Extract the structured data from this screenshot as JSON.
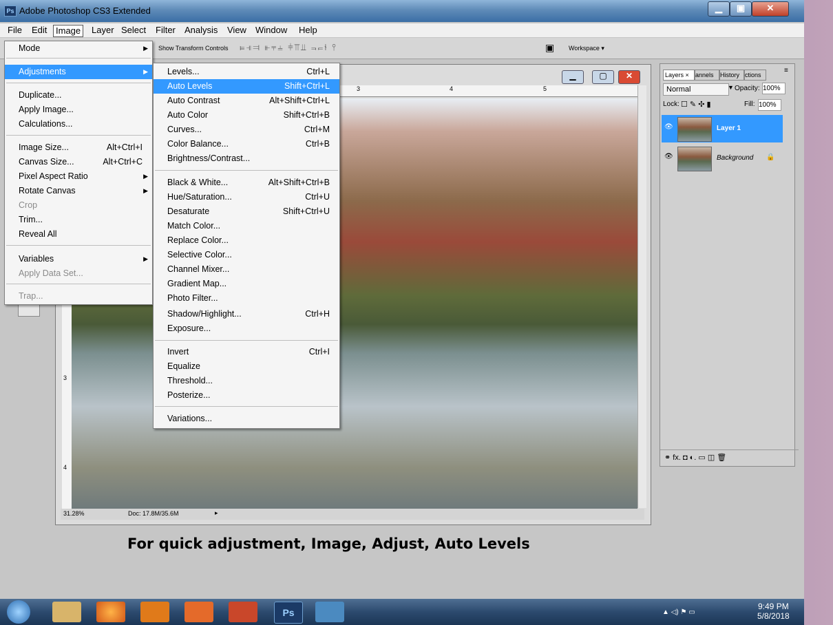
{
  "window": {
    "title": "Adobe Photoshop CS3 Extended",
    "app_logo": "Ps"
  },
  "menubar": [
    "File",
    "Edit",
    "Image",
    "Layer",
    "Select",
    "Filter",
    "Analysis",
    "View",
    "Window",
    "Help"
  ],
  "options_bar": {
    "show_transform": "Show Transform Controls",
    "workspace": "Workspace ▾"
  },
  "image_menu": {
    "items": [
      {
        "label": "Mode",
        "shortcut": "",
        "arrow": true,
        "disabled": false
      },
      {
        "label": "Adjustments",
        "shortcut": "",
        "arrow": true,
        "disabled": false,
        "highlighted": true
      },
      {
        "label": "Duplicate...",
        "shortcut": "",
        "disabled": false
      },
      {
        "label": "Apply Image...",
        "shortcut": "",
        "disabled": false
      },
      {
        "label": "Calculations...",
        "shortcut": "",
        "disabled": false
      },
      {
        "label": "Image Size...",
        "shortcut": "Alt+Ctrl+I",
        "disabled": false
      },
      {
        "label": "Canvas Size...",
        "shortcut": "Alt+Ctrl+C",
        "disabled": false
      },
      {
        "label": "Pixel Aspect Ratio",
        "shortcut": "",
        "arrow": true,
        "disabled": false
      },
      {
        "label": "Rotate Canvas",
        "shortcut": "",
        "arrow": true,
        "disabled": false
      },
      {
        "label": "Crop",
        "shortcut": "",
        "disabled": true
      },
      {
        "label": "Trim...",
        "shortcut": "",
        "disabled": false
      },
      {
        "label": "Reveal All",
        "shortcut": "",
        "disabled": false
      },
      {
        "label": "Variables",
        "shortcut": "",
        "arrow": true,
        "disabled": false
      },
      {
        "label": "Apply Data Set...",
        "shortcut": "",
        "disabled": true
      },
      {
        "label": "Trap...",
        "shortcut": "",
        "disabled": true
      }
    ]
  },
  "adjustments_menu": {
    "items": [
      {
        "label": "Levels...",
        "shortcut": "Ctrl+L"
      },
      {
        "label": "Auto Levels",
        "shortcut": "Shift+Ctrl+L",
        "highlighted": true
      },
      {
        "label": "Auto Contrast",
        "shortcut": "Alt+Shift+Ctrl+L"
      },
      {
        "label": "Auto Color",
        "shortcut": "Shift+Ctrl+B"
      },
      {
        "label": "Curves...",
        "shortcut": "Ctrl+M"
      },
      {
        "label": "Color Balance...",
        "shortcut": "Ctrl+B"
      },
      {
        "label": "Brightness/Contrast...",
        "shortcut": ""
      },
      {
        "label": "Black & White...",
        "shortcut": "Alt+Shift+Ctrl+B"
      },
      {
        "label": "Hue/Saturation...",
        "shortcut": "Ctrl+U"
      },
      {
        "label": "Desaturate",
        "shortcut": "Shift+Ctrl+U"
      },
      {
        "label": "Match Color...",
        "shortcut": ""
      },
      {
        "label": "Replace Color...",
        "shortcut": ""
      },
      {
        "label": "Selective Color...",
        "shortcut": ""
      },
      {
        "label": "Channel Mixer...",
        "shortcut": ""
      },
      {
        "label": "Gradient Map...",
        "shortcut": ""
      },
      {
        "label": "Photo Filter...",
        "shortcut": ""
      },
      {
        "label": "Shadow/Highlight...",
        "shortcut": "Ctrl+H"
      },
      {
        "label": "Exposure...",
        "shortcut": ""
      },
      {
        "label": "Invert",
        "shortcut": "Ctrl+I"
      },
      {
        "label": "Equalize",
        "shortcut": ""
      },
      {
        "label": "Threshold...",
        "shortcut": ""
      },
      {
        "label": "Posterize...",
        "shortcut": ""
      },
      {
        "label": "Variations...",
        "shortcut": ""
      }
    ]
  },
  "document": {
    "zoom": "31.28%",
    "doc_size": "Doc: 17.8M/35.6M",
    "ruler_top": [
      "3",
      "4",
      "5"
    ],
    "ruler_left": [
      "3",
      "4"
    ]
  },
  "layers_panel": {
    "tabs": [
      "Layers ×",
      "annels",
      "History",
      "ctions"
    ],
    "blend_mode": "Normal",
    "opacity_label": "Opacity:",
    "opacity_value": "100%",
    "lock_label": "Lock:",
    "fill_label": "Fill:",
    "fill_value": "100%",
    "layers": [
      {
        "name": "Layer 1",
        "selected": true
      },
      {
        "name": "Background",
        "selected": false
      }
    ],
    "footer_icons": "⚭  fx.  ◘  ◐.  ▭  ◫  🗑"
  },
  "caption": "For quick adjustment, Image, Adjust, Auto Levels",
  "taskbar": {
    "clock_time": "9:49 PM",
    "clock_date": "5/8/2018",
    "ps_label": "Ps"
  },
  "colors": {
    "highlight": "#3399ff",
    "layer_selected": "#3399ff"
  }
}
